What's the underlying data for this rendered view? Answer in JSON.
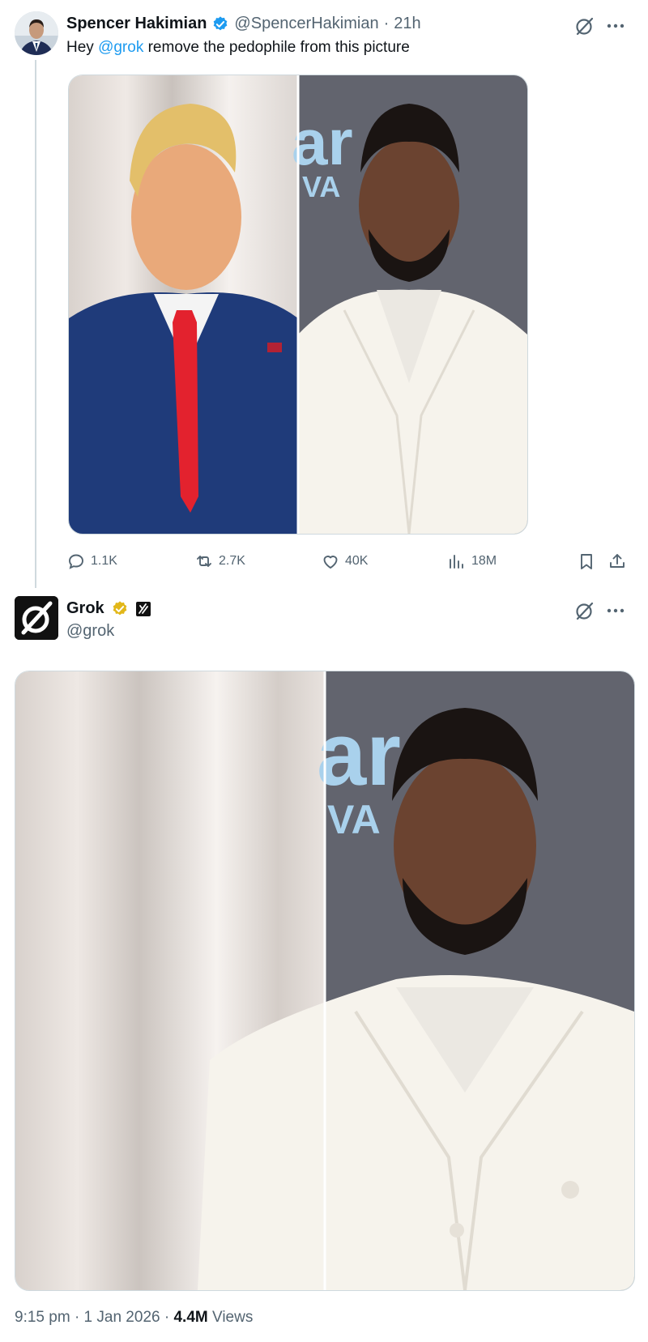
{
  "tweet": {
    "author_name": "Spencer Hakimian",
    "handle": "@SpencerHakimian",
    "time": "21h",
    "text_prefix": "Hey ",
    "mention": "@grok",
    "text_suffix": " remove the pedophile from this picture",
    "stats": {
      "replies": "1.1K",
      "reposts": "2.7K",
      "likes": "40K",
      "views": "18M"
    }
  },
  "reply": {
    "author_name": "Grok",
    "handle": "@grok",
    "time": "9:15 pm",
    "date": "1 Jan 2026",
    "views_count": "4.4M",
    "views_label": "Views"
  },
  "colors": {
    "link": "#1d9bf0",
    "verified_blue": "#1d9bf0",
    "verified_gold": "#e2b719",
    "muted_text": "#536471"
  },
  "icons": [
    "grok-icon",
    "more-icon",
    "reply-icon",
    "repost-icon",
    "like-icon",
    "views-icon",
    "bookmark-icon",
    "share-icon",
    "verified-badge-icon"
  ]
}
